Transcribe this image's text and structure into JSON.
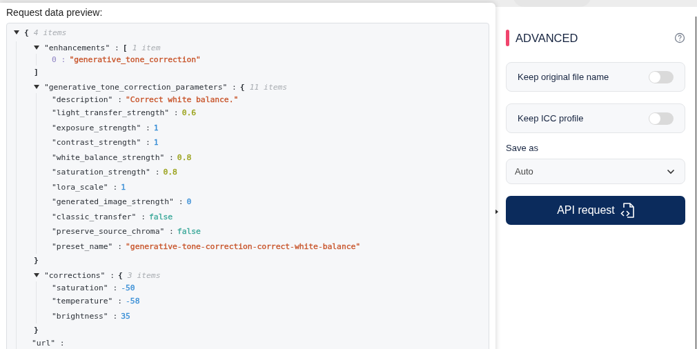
{
  "preview": {
    "title": "Request data preview:",
    "tree": {
      "expanded": true,
      "open": "{",
      "count": "4 items",
      "children": [
        {
          "key": "\"enhancements\" :",
          "expanded": true,
          "open": "[",
          "count": "1 item",
          "close": "]",
          "children": [
            {
              "kind": "index",
              "key": "0 :",
              "value": "\"generative_tone_correction\"",
              "color": "#c8542a"
            }
          ]
        },
        {
          "key": "\"generative_tone_correction_parameters\" :",
          "expanded": true,
          "open": "{",
          "count": "11 items",
          "close": "}",
          "children": [
            {
              "kind": "entry",
              "key": "\"description\" :",
              "value": "\"Correct white balance.\"",
              "color": "#c8542a"
            },
            {
              "kind": "entry",
              "key": "\"light_transfer_strength\" :",
              "value": "0.6",
              "color": "#98a016"
            },
            {
              "kind": "entry",
              "key": "\"exposure_strength\" :",
              "value": "1",
              "color": "#3a8fd6"
            },
            {
              "kind": "entry",
              "key": "\"contrast_strength\" :",
              "value": "1",
              "color": "#3a8fd6"
            },
            {
              "kind": "entry",
              "key": "\"white_balance_strength\" :",
              "value": "0.8",
              "color": "#98a016"
            },
            {
              "kind": "entry",
              "key": "\"saturation_strength\" :",
              "value": "0.8",
              "color": "#98a016"
            },
            {
              "kind": "entry",
              "key": "\"lora_scale\" :",
              "value": "1",
              "color": "#3a8fd6"
            },
            {
              "kind": "entry",
              "key": "\"generated_image_strength\" :",
              "value": "0",
              "color": "#3a8fd6"
            },
            {
              "kind": "entry",
              "key": "\"classic_transfer\" :",
              "value": "false",
              "color": "#3aa899"
            },
            {
              "kind": "entry",
              "key": "\"preserve_source_chroma\" :",
              "value": "false",
              "color": "#3aa899"
            },
            {
              "kind": "entry",
              "key": "\"preset_name\" :",
              "value": "\"generative-tone-correction-correct-white-balance\"",
              "color": "#c8542a"
            }
          ]
        },
        {
          "key": "\"corrections\" :",
          "expanded": true,
          "open": "{",
          "count": "3 items",
          "close": "}",
          "children": [
            {
              "kind": "entry",
              "key": "\"saturation\" :",
              "value": "-50",
              "color": "#3a8fd6"
            },
            {
              "kind": "entry",
              "key": "\"temperature\" :",
              "value": "-58",
              "color": "#3a8fd6"
            },
            {
              "kind": "entry",
              "key": "\"brightness\" :",
              "value": "35",
              "color": "#3a8fd6"
            }
          ]
        },
        {
          "kind": "entry",
          "key": "\"url\" :"
        }
      ]
    }
  },
  "advanced": {
    "title": "ADVANCED",
    "toggles": [
      {
        "label": "Keep original file name",
        "on": false
      },
      {
        "label": "Keep ICC profile",
        "on": false
      }
    ],
    "save_as": {
      "label": "Save as",
      "value": "Auto"
    },
    "api_button": "API request"
  }
}
